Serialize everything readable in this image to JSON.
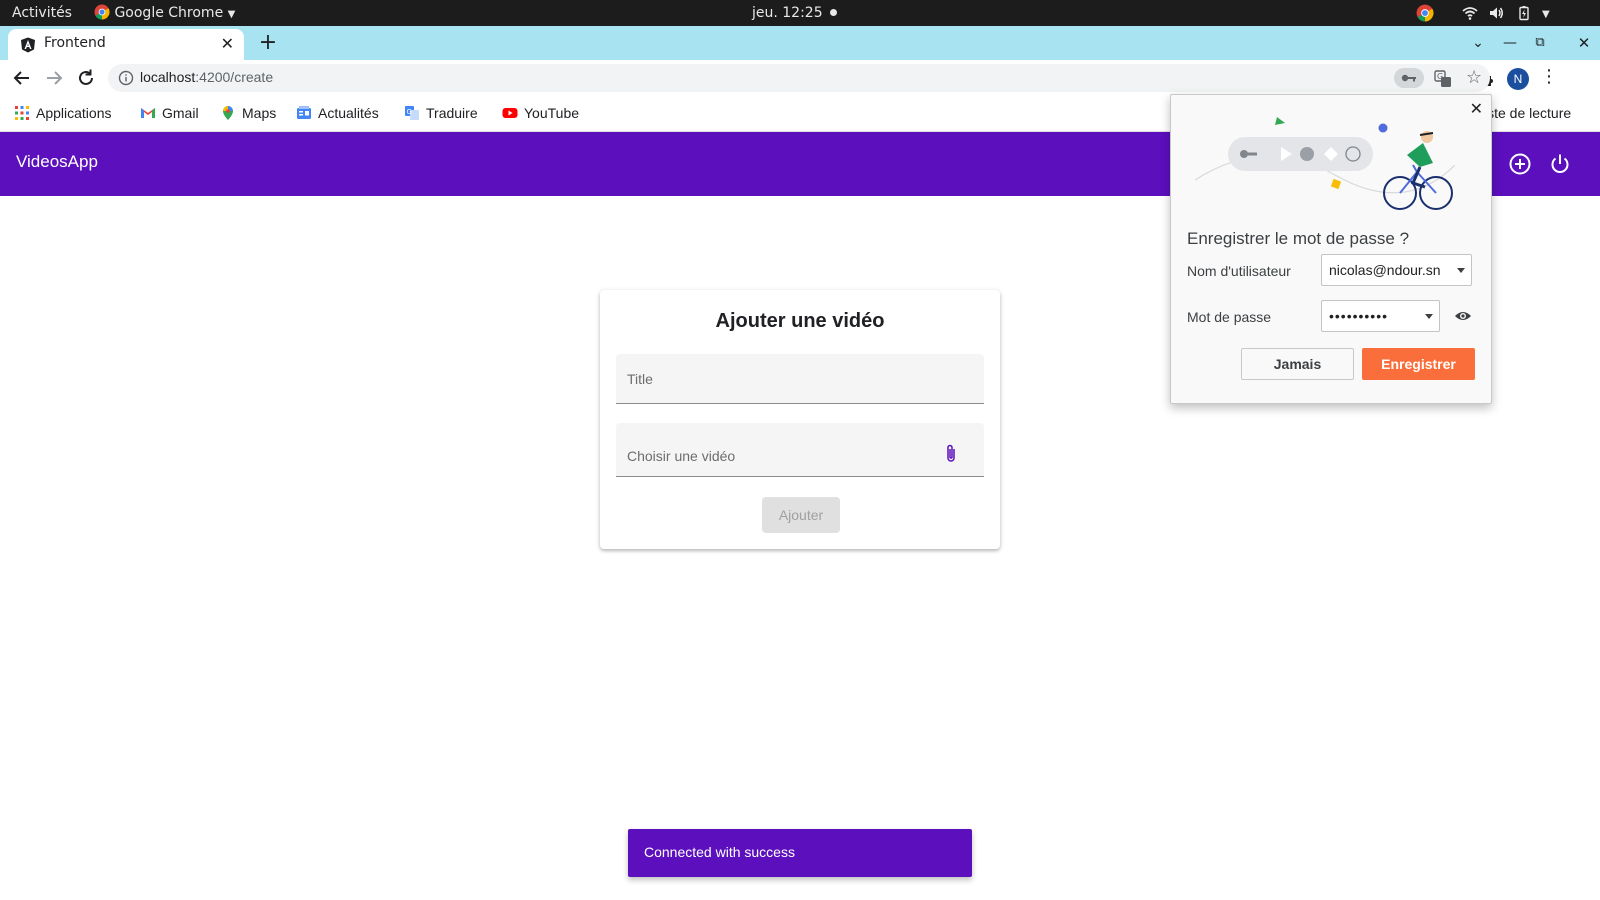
{
  "os_bar": {
    "activities": "Activités",
    "app_name": "Google Chrome",
    "clock": "jeu. 12:25"
  },
  "browser": {
    "tab_title": "Frontend",
    "url_host": "localhost",
    "url_rest": ":4200/create",
    "avatar_initial": "N",
    "bookmarks": [
      "Applications",
      "Gmail",
      "Maps",
      "Actualités",
      "Traduire",
      "YouTube"
    ],
    "bookmark_overflow": "Liste de lecture",
    "bookmark_overflow_visible": "iste de lecture"
  },
  "app": {
    "brand": "VideosApp",
    "accent": "#5b0fbd"
  },
  "card": {
    "heading": "Ajouter une vidéo",
    "title_placeholder": "Title",
    "video_placeholder": "Choisir une vidéo",
    "add_label": "Ajouter"
  },
  "password_prompt": {
    "title": "Enregistrer le mot de passe ?",
    "username_label": "Nom d'utilisateur",
    "username_value": "nicolas@ndour.sn",
    "password_label": "Mot de passe",
    "password_value": "••••••••••",
    "never_label": "Jamais",
    "save_label": "Enregistrer",
    "save_color": "#f96e3a"
  },
  "snackbar": {
    "message": "Connected with success"
  }
}
